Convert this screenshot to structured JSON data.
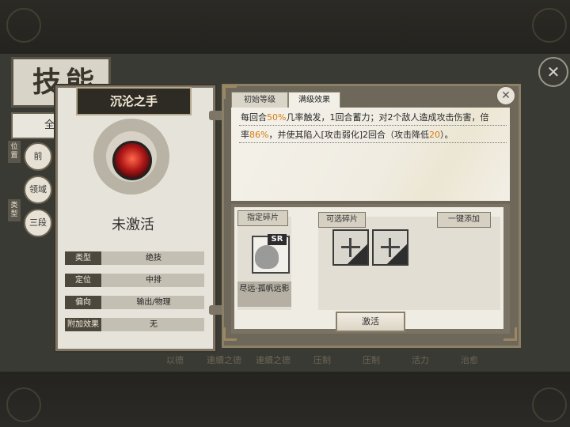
{
  "screen": {
    "title": "技能",
    "all_tab": "全"
  },
  "side_filters": {
    "position_label": "位置",
    "type_label": "类型",
    "buttons": [
      "前",
      "领域",
      "三段"
    ]
  },
  "bottom_strip": [
    "以德",
    "連續之德",
    "連續之德",
    "压制",
    "压制",
    "活力",
    "治愈"
  ],
  "skill": {
    "name": "沉沦之手",
    "status": "未激活",
    "attributes": [
      {
        "key": "类型",
        "value": "绝技"
      },
      {
        "key": "定位",
        "value": "中排"
      },
      {
        "key": "偏向",
        "value": "输出/物理"
      },
      {
        "key": "附加效果",
        "value": "无"
      }
    ]
  },
  "detail": {
    "tabs": [
      "初始等级",
      "满级效果"
    ],
    "active_tab": "满级效果",
    "desc": {
      "p1": "每回合",
      "h1": "50%",
      "p2": "几率触发，1回合蓄力；对2个敌人造成攻击伤害，倍",
      "p3": "率",
      "h2": "86%",
      "p4": "，并使其陷入[攻击弱化]2回合（攻击降低",
      "h3": "20",
      "p5": "）。"
    },
    "fragments": {
      "assigned_label": "指定碎片",
      "assigned_item": {
        "badge": "SR",
        "name": "尽远·孤帆远影"
      },
      "optional_label": "可选碎片",
      "auto_add_label": "一键添加",
      "slots": [
        "+",
        "+"
      ]
    },
    "activate_label": "激活"
  },
  "colors": {
    "highlight": "#d57b10",
    "panel_border": "#8b7f66"
  }
}
